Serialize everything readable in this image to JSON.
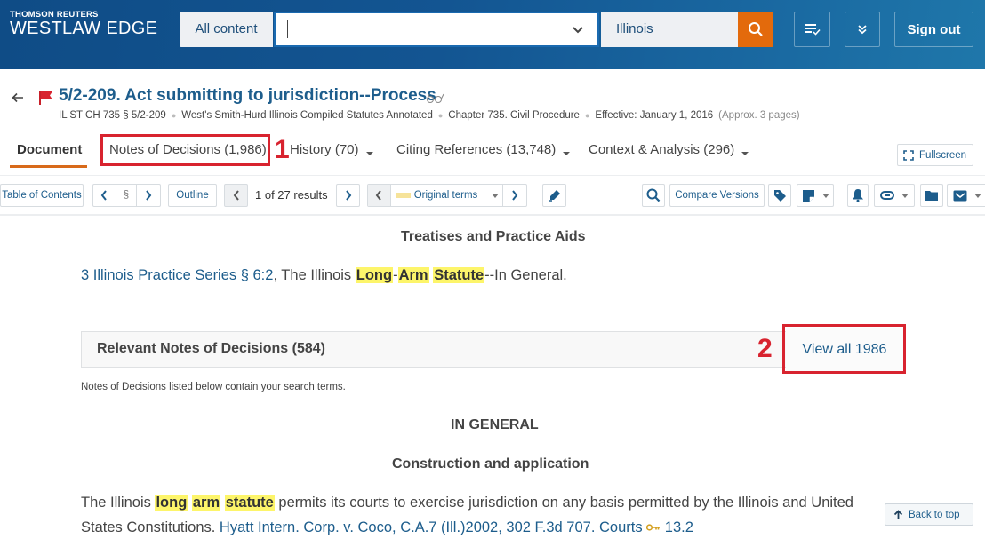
{
  "header": {
    "brand_top": "THOMSON REUTERS",
    "brand_main": "WESTLAW EDGE",
    "scope_label": "All content",
    "search_value": "",
    "jurisdiction": "Illinois",
    "sign_out": "Sign out",
    "icons": [
      "search-icon",
      "checklist-icon",
      "double-chevron-down-icon"
    ]
  },
  "document": {
    "title": "5/2-209. Act submitting to jurisdiction--Process",
    "citation": "IL ST CH 735 § 5/2-209",
    "publication": "West's Smith-Hurd Illinois Compiled Statutes Annotated",
    "chapter": "Chapter 735. Civil Procedure",
    "effective": "Effective: January 1, 2016",
    "length": "(Approx. 3 pages)"
  },
  "tabs": [
    {
      "label": "Document",
      "active": true
    },
    {
      "label": "Notes of Decisions (1,986)"
    },
    {
      "label": "History (70)",
      "dropdown": true
    },
    {
      "label": "Citing References (13,748)",
      "dropdown": true
    },
    {
      "label": "Context & Analysis (296)",
      "dropdown": true
    }
  ],
  "fullscreen_label": "Fullscreen",
  "annotations": {
    "first": "1",
    "second": "2",
    "color": "#d8232f"
  },
  "toolbar": {
    "toc": "Table of Contents",
    "section_symbol": "§",
    "outline": "Outline",
    "results": "1 of 27 results",
    "terms": "Original terms",
    "compare": "Compare Versions"
  },
  "content": {
    "treatises_heading": "Treatises and Practice Aids",
    "treatise_link": "3 Illinois Practice Series § 6:2",
    "treatise_text_pre": ", The Illinois ",
    "treatise_hl": [
      "Long",
      "Arm",
      "Statute"
    ],
    "treatise_text_post": "--In General.",
    "notes_heading": "Relevant Notes of Decisions (584)",
    "view_all": "View all 1986",
    "notes_sub": "Notes of Decisions listed below contain your search terms.",
    "in_general": "IN GENERAL",
    "construction": "Construction and application",
    "para_pre": "The Illinois ",
    "para_hl": [
      "long",
      "arm",
      "statute"
    ],
    "para_post": " permits its courts to exercise jurisdiction on any basis permitted by the Illinois and United",
    "para2_pre": "States Constitutions. ",
    "case_link": "Hyatt Intern. Corp. v. Coco, C.A.7 (Ill.)2002, 302 F.3d 707.",
    "keynote_topic": "Courts",
    "keynote_num": "13.2"
  },
  "back_to_top": "Back to top",
  "colors": {
    "brand_blue": "#135592",
    "search_orange": "#e36a0c",
    "link": "#1d5d8c",
    "highlight": "#fdf56a",
    "tab_underline": "#d86a1a"
  }
}
